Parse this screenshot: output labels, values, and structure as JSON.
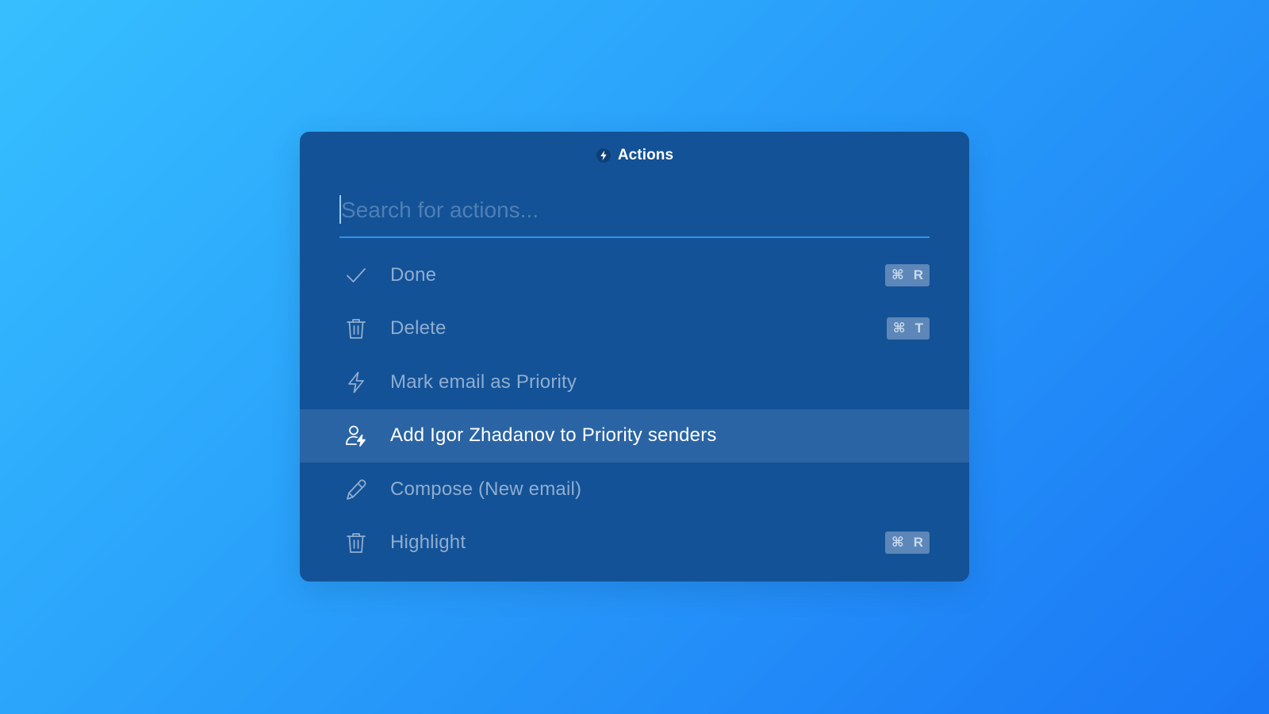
{
  "palette": {
    "title": "Actions",
    "title_icon": "bolt-circle-icon",
    "search": {
      "placeholder": "Search for actions...",
      "value": ""
    },
    "items": [
      {
        "label": "Done",
        "icon": "check-icon",
        "shortcut": {
          "mod": "⌘",
          "key": "R"
        },
        "active": false
      },
      {
        "label": "Delete",
        "icon": "trash-icon",
        "shortcut": {
          "mod": "⌘",
          "key": "T"
        },
        "active": false
      },
      {
        "label": "Mark email as Priority",
        "icon": "bolt-icon",
        "shortcut": null,
        "active": false
      },
      {
        "label": "Add Igor Zhadanov to Priority senders",
        "icon": "user-bolt-icon",
        "shortcut": null,
        "active": true
      },
      {
        "label": "Compose (New email)",
        "icon": "pencil-icon",
        "shortcut": null,
        "active": false
      },
      {
        "label": "Highlight",
        "icon": "trash-icon",
        "shortcut": {
          "mod": "⌘",
          "key": "R"
        },
        "active": false
      }
    ]
  },
  "colors": {
    "background_start": "#36bfff",
    "background_end": "#1a77f5",
    "panel": "#135296",
    "active_row": "#2a64a4",
    "search_underline": "#2e93ea"
  }
}
